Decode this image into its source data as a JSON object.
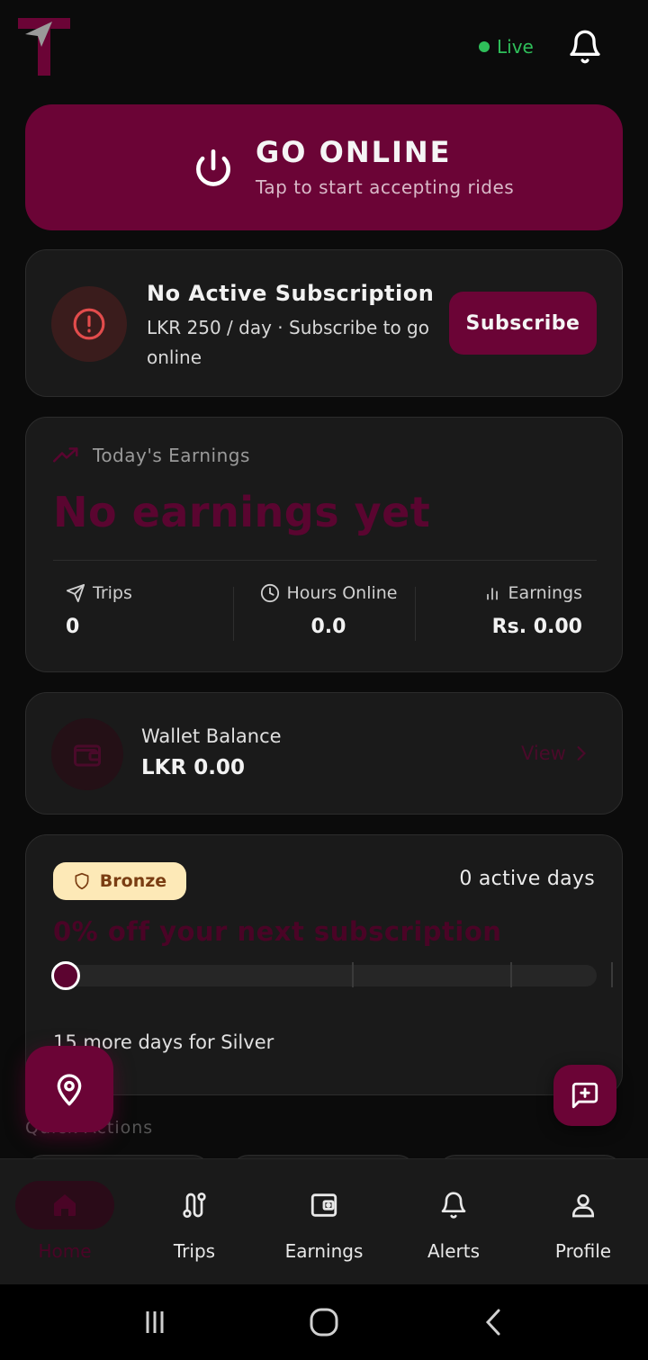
{
  "header": {
    "logo_icon": "navigation-arrow-logo-icon",
    "status_text": "Live",
    "status_color": "#2fbf5a",
    "bell_icon": "bell-icon"
  },
  "go_online": {
    "title": "GO ONLINE",
    "subtitle": "Tap to start accepting rides",
    "icon": "power-icon",
    "color": "#6b0436"
  },
  "subscription": {
    "title": "No Active Subscription",
    "description": "LKR 250 / day · Subscribe to go online",
    "button_label": "Subscribe",
    "icon": "alert-circle-icon"
  },
  "earnings": {
    "label": "Today's Earnings",
    "headline": "No earnings yet",
    "stats": [
      {
        "label": "Trips",
        "value": "0",
        "icon": "send-icon"
      },
      {
        "label": "Hours Online",
        "value": "0.0",
        "icon": "clock-icon"
      },
      {
        "label": "Earnings",
        "value": "Rs. 0.00",
        "icon": "bar-chart-icon"
      }
    ]
  },
  "wallet": {
    "label": "Wallet Balance",
    "value": "LKR 0.00",
    "link": "View",
    "icon": "wallet-icon"
  },
  "loyalty": {
    "tier": "Bronze",
    "active_days": "0 active days",
    "discount": "0% off your next subscription",
    "progress": 0,
    "next_tier_text": "15 more days for Silver"
  },
  "quick_actions": {
    "label": "Quick Actions"
  },
  "bottom_nav": {
    "items": [
      {
        "label": "Home",
        "icon": "home-icon",
        "active": true
      },
      {
        "label": "Trips",
        "icon": "route-icon",
        "active": false
      },
      {
        "label": "Earnings",
        "icon": "wallet-icon",
        "active": false
      },
      {
        "label": "Alerts",
        "icon": "bell-icon",
        "active": false
      },
      {
        "label": "Profile",
        "icon": "user-icon",
        "active": false
      }
    ]
  }
}
